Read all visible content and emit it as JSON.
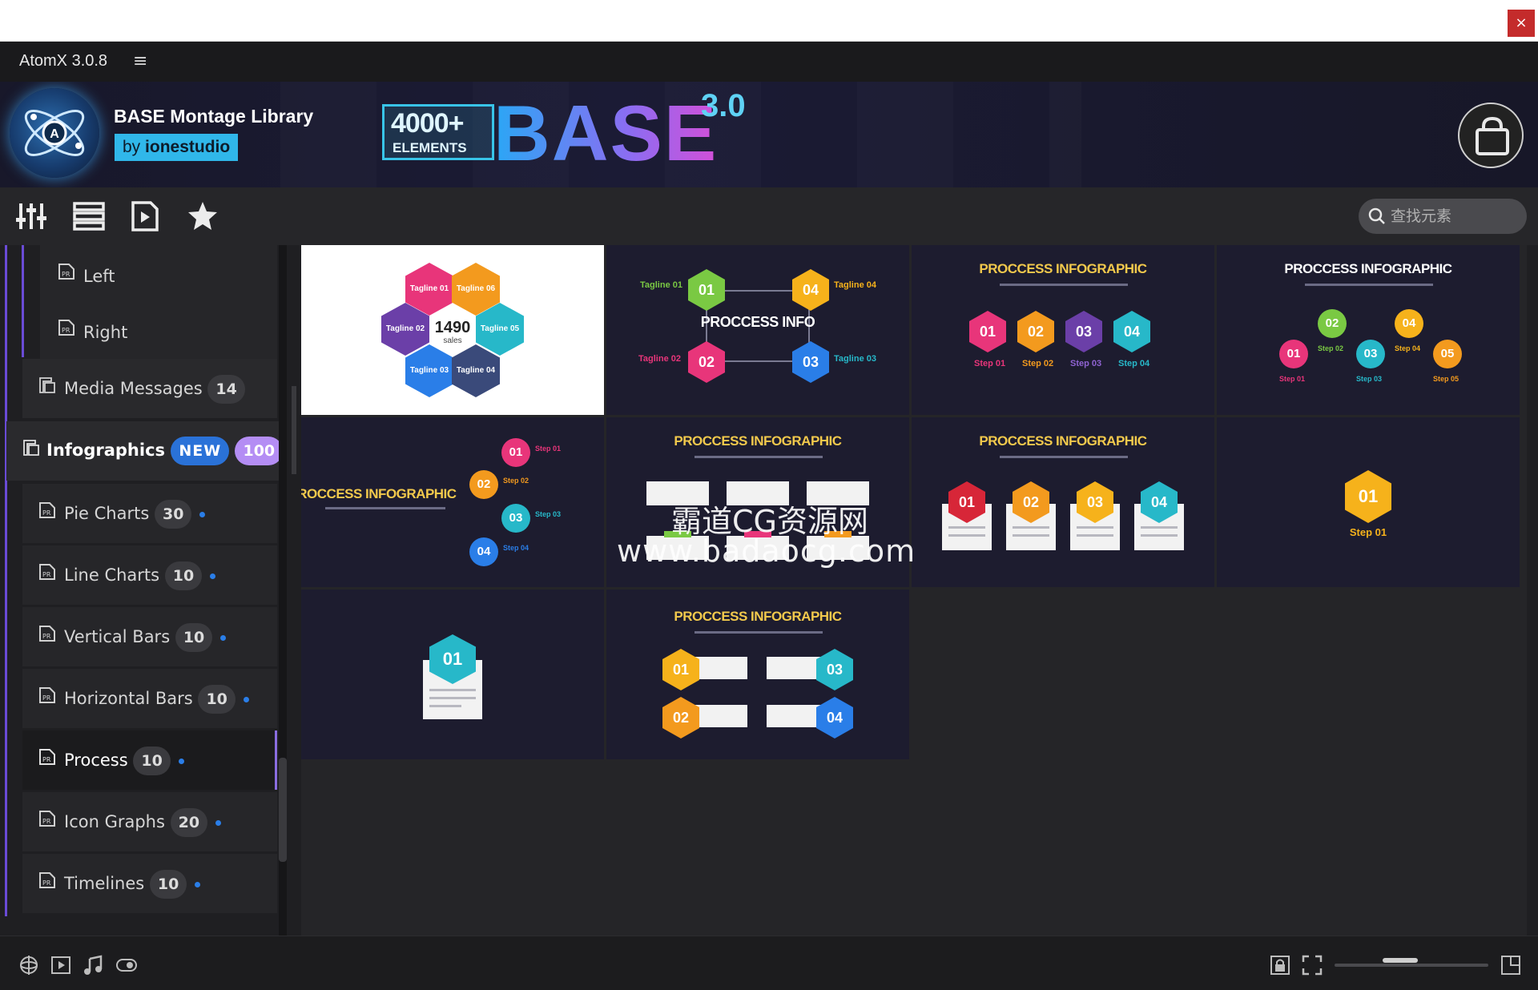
{
  "window": {
    "close_label": "×"
  },
  "app": {
    "title": "AtomX 3.0.8",
    "menu_glyph": "≡"
  },
  "banner": {
    "library_name": "BASE Montage Library",
    "author_prefix": "by",
    "author": "ionestudio",
    "brand_count": "4000+",
    "brand_sub": "ELEMENTS",
    "brand_word": "BASE",
    "brand_version": "3.0",
    "accent_color": "#30b7ea"
  },
  "toolbar": {
    "tools": [
      {
        "name": "sliders-icon"
      },
      {
        "name": "list-icon"
      },
      {
        "name": "play-file-icon"
      },
      {
        "name": "star-icon"
      }
    ],
    "search_placeholder": "查找元素"
  },
  "sidebar": {
    "items": [
      {
        "label": "Left",
        "level": 2
      },
      {
        "label": "Right",
        "level": 2
      },
      {
        "label": "Media Messages",
        "count": "14",
        "level": 1
      },
      {
        "label": "Infographics",
        "new": "NEW",
        "count": "100",
        "level": 0
      },
      {
        "label": "Pie Charts",
        "count": "30",
        "level": 1
      },
      {
        "label": "Line Charts",
        "count": "10",
        "level": 1
      },
      {
        "label": "Vertical Bars",
        "count": "10",
        "level": 1
      },
      {
        "label": "Horizontal Bars",
        "count": "10",
        "level": 1
      },
      {
        "label": "Process",
        "count": "10",
        "level": 1,
        "selected": true
      },
      {
        "label": "Icon Graphs",
        "count": "20",
        "level": 1
      },
      {
        "label": "Timelines",
        "count": "10",
        "level": 1
      }
    ]
  },
  "thumbnails": {
    "t1": {
      "center_value": "1490",
      "center_sub": "sales",
      "taglines": [
        "Tagline 01",
        "Tagline 06",
        "Tagline 02",
        "Tagline 05",
        "Tagline 03",
        "Tagline 04"
      ]
    },
    "t2": {
      "title": "PROCCESS INFO",
      "taglines": [
        "Tagline 01",
        "Tagline 04",
        "Tagline 02",
        "Tagline 03"
      ],
      "nums": [
        "01",
        "04",
        "02",
        "03"
      ]
    },
    "t3": {
      "title": "PROCCESS INFOGRAPHIC",
      "nums": [
        "01",
        "02",
        "03",
        "04"
      ],
      "steps": [
        "Step 01",
        "Step 02",
        "Step 03",
        "Step 04"
      ]
    },
    "t4": {
      "title": "PROCCESS INFOGRAPHIC",
      "nums": [
        "01",
        "02",
        "03",
        "04",
        "05"
      ],
      "steps": [
        "Step 01",
        "Step 02",
        "Step 03",
        "Step 04",
        "Step 05"
      ]
    },
    "t5": {
      "title": "PROCCESS INFOGRAPHIC",
      "nums": [
        "01",
        "02",
        "03",
        "04"
      ],
      "steps": [
        "Step 01",
        "Step 02",
        "Step 03",
        "Step 04"
      ]
    },
    "t6": {
      "title": "PROCCESS INFOGRAPHIC"
    },
    "t7": {
      "title": "PROCCESS INFOGRAPHIC",
      "nums": [
        "01",
        "02",
        "03",
        "04"
      ]
    },
    "t8": {
      "num": "01",
      "step": "Step 01"
    },
    "t9": {
      "num": "01"
    },
    "t10": {
      "title": "PROCCESS INFOGRAPHIC",
      "nums": [
        "01",
        "03",
        "02",
        "04"
      ]
    }
  },
  "watermark": {
    "line1": "霸道CG资源网",
    "line2": "www.badaocg.com"
  },
  "colors": {
    "pink": "#e8357a",
    "orange": "#f39a1e",
    "purple": "#6b3fa8",
    "teal": "#27b8c9",
    "blue": "#2a7ee8",
    "yellow": "#f6b21b",
    "green": "#7ac943",
    "navy": "#3a4a7a"
  }
}
